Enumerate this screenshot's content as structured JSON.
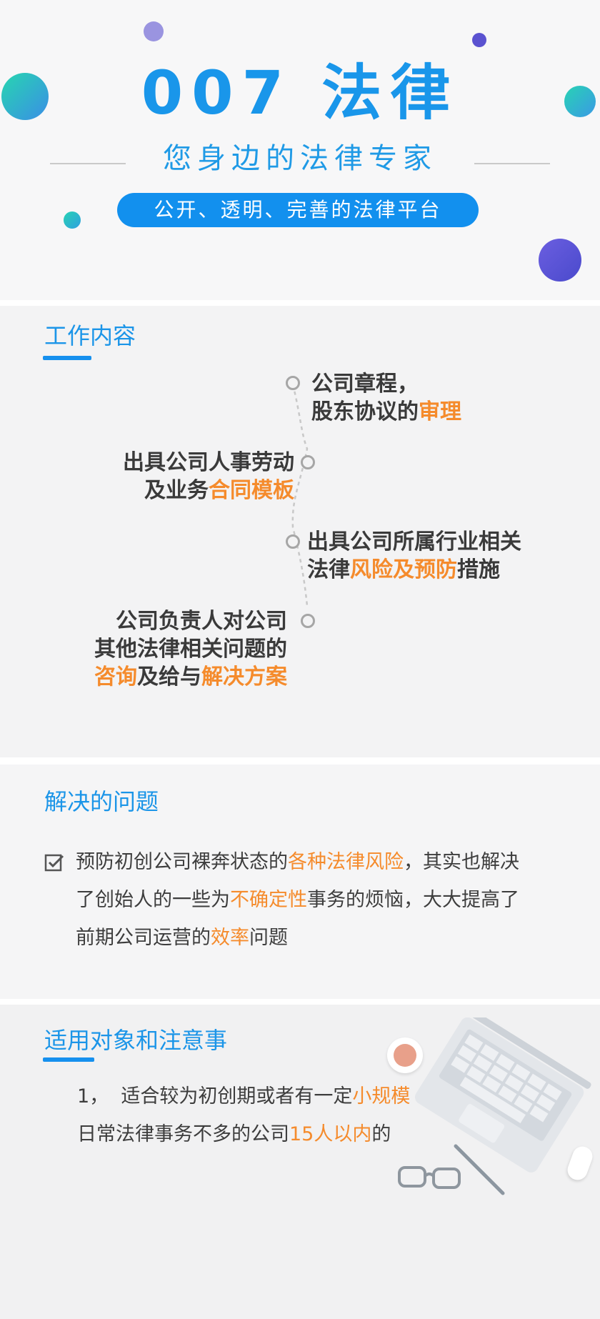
{
  "hero": {
    "title": "007 法律",
    "subtitle": "您身边的法律专家",
    "tagline": "公开、透明、完善的法律平台"
  },
  "work": {
    "title": "工作内容",
    "items": [
      {
        "line1": "公司章程，",
        "line2_plain": "股东协议的",
        "line2_hl": "审理"
      },
      {
        "line1": "出具公司人事劳动",
        "line2_plain": "及业务",
        "line2_hl": "合同模板"
      },
      {
        "line1": "出具公司所属行业相关",
        "line2_plain": "法律",
        "line2_hl": "风险及预防",
        "line2_tail": "措施"
      },
      {
        "line1": "公司负责人对公司",
        "line2": "其他法律相关问题的",
        "line3_hl1": "咨询",
        "line3_plain": "及给与",
        "line3_hl2": "解决方案"
      }
    ]
  },
  "problems": {
    "title": "解决的问题",
    "text": {
      "p1": "预防初创公司裸奔状态的",
      "h1": "各种法律风险",
      "p2": "，其实也解决",
      "p3": "了创始人的一些为",
      "h2": "不确定性",
      "p4": "事务的烦恼，大大提高了",
      "p5": "前期公司运营的",
      "h3": "效率",
      "p6": "问题"
    }
  },
  "audience": {
    "title": "适用对象和注意事",
    "text": {
      "p1": "1，  适合较为初创期或者有一定",
      "h1": "小规模",
      "p2": "日常法律事务不多的公司",
      "h2": "15人以内",
      "p3": "的"
    }
  },
  "colors": {
    "accent_blue": "#1996ea",
    "highlight_orange": "#f58b2c",
    "section_bg": "#f3f3f4"
  }
}
